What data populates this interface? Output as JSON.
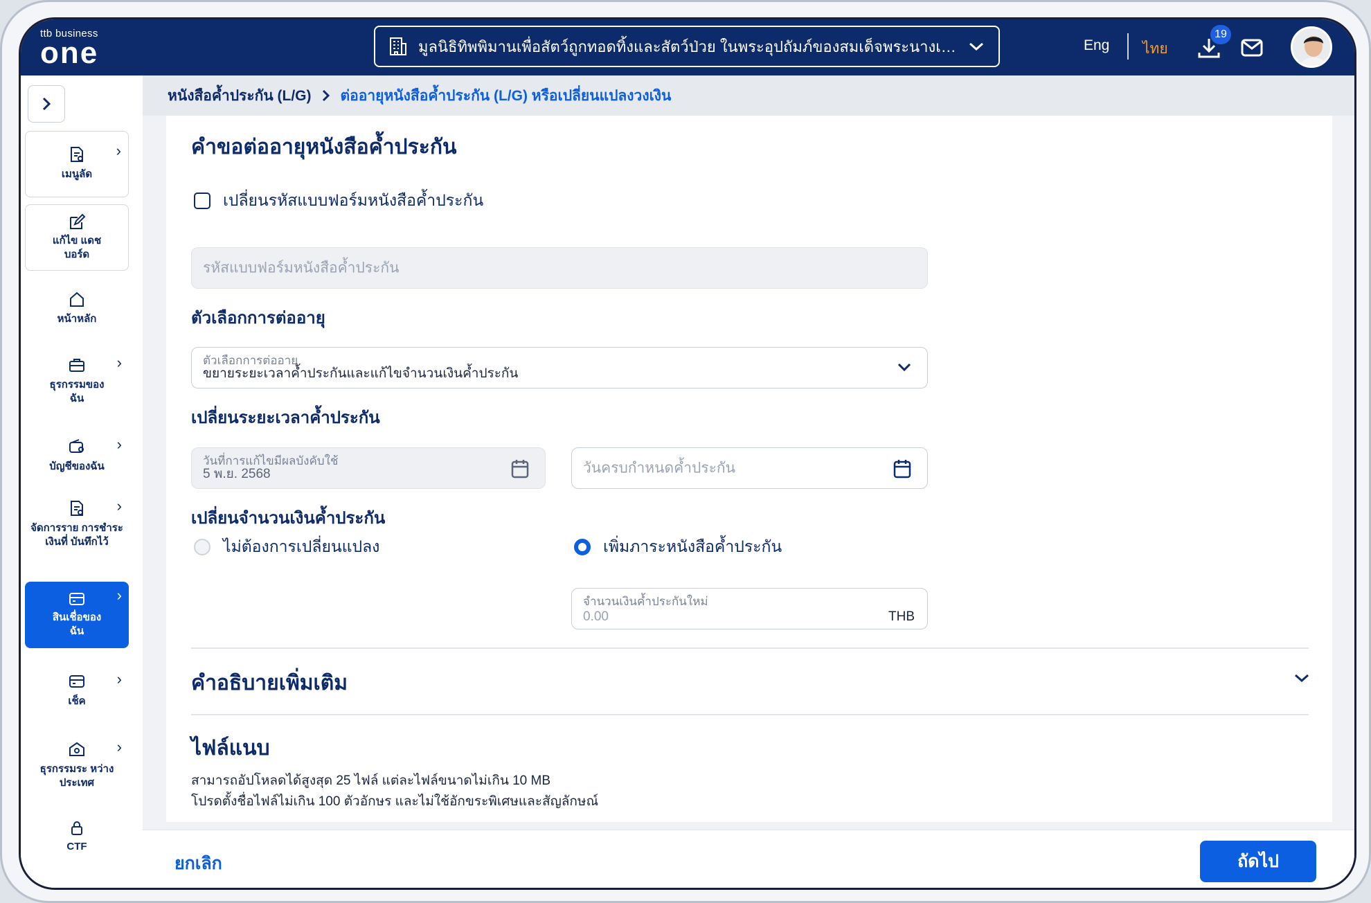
{
  "header": {
    "logo_small": "ttb business",
    "logo_big": "one",
    "org_name": "มูลนิธิทิพพิมานเพื่อสัตว์ถูกทอดทิ้งและสัตว์ป่วย ในพระอุปถัมภ์ของสมเด็จพระนางเจ้า...",
    "lang_en": "Eng",
    "lang_th": "ไทย",
    "download_badge": "19"
  },
  "sidebar": {
    "items": [
      {
        "label": "เมนูลัด"
      },
      {
        "label": "แก้ไข แดชบอร์ด"
      },
      {
        "label": "หน้าหลัก"
      },
      {
        "label": "ธุรกรรมของ ฉัน"
      },
      {
        "label": "บัญชีของฉัน"
      },
      {
        "label": "จัดการราย การชำระเงินที่ บันทึกไว้"
      },
      {
        "label": "สินเชื่อของ ฉัน"
      },
      {
        "label": "เช็ค"
      },
      {
        "label": "ธุรกรรมระ หว่างประเทศ"
      },
      {
        "label": "CTF"
      }
    ]
  },
  "breadcrumb": {
    "parent": "หนังสือค้ำประกัน (L/G)",
    "current": "ต่ออายุหนังสือค้ำประกัน (L/G) หรือเปลี่ยนแปลงวงเงิน"
  },
  "form": {
    "title": "คำขอต่ออายุหนังสือค้ำประกัน",
    "change_code_checkbox": "เปลี่ยนรหัสแบบฟอร์มหนังสือค้ำประกัน",
    "code_placeholder": "รหัสแบบฟอร์มหนังสือค้ำประกัน",
    "renewal_section": "ตัวเลือกการต่ออายุ",
    "renewal_label": "ตัวเลือกการต่ออายุ",
    "renewal_value": "ขยายระยะเวลาค้ำประกันและแก้ไขจำนวนเงินค้ำประกัน",
    "period_section": "เปลี่ยนระยะเวลาค้ำประกัน",
    "effective_label": "วันที่การแก้ไขมีผลบังคับใช้",
    "effective_value": "5 พ.ย. 2568",
    "due_placeholder": "วันครบกำหนดค้ำประกัน",
    "amount_section": "เปลี่ยนจำนวนเงินค้ำประกัน",
    "radio_no_change": "ไม่ต้องการเปลี่ยนแปลง",
    "radio_increase": "เพิ่มภาระหนังสือค้ำประกัน",
    "new_amount_label": "จำนวนเงินค้ำประกันใหม่",
    "new_amount_value": "0.00",
    "currency": "THB",
    "extra_section": "คำอธิบายเพิ่มเติม",
    "attach_section": "ไฟล์แนบ",
    "attach_note_1": "สามารถอัปโหลดได้สูงสุด 25 ไฟล์ แต่ละไฟล์ขนาดไม่เกิน 10 MB",
    "attach_note_2": "โปรดตั้งชื่อไฟล์ไม่เกิน 100 ตัวอักษร และไม่ใช้อักขระพิเศษและสัญลักษณ์"
  },
  "footer": {
    "cancel": "ยกเลิก",
    "next": "ถัดไป"
  },
  "colors": {
    "navy": "#0d2b6b",
    "primary": "#0b5fe0",
    "accent_orange": "#f59e2a"
  }
}
